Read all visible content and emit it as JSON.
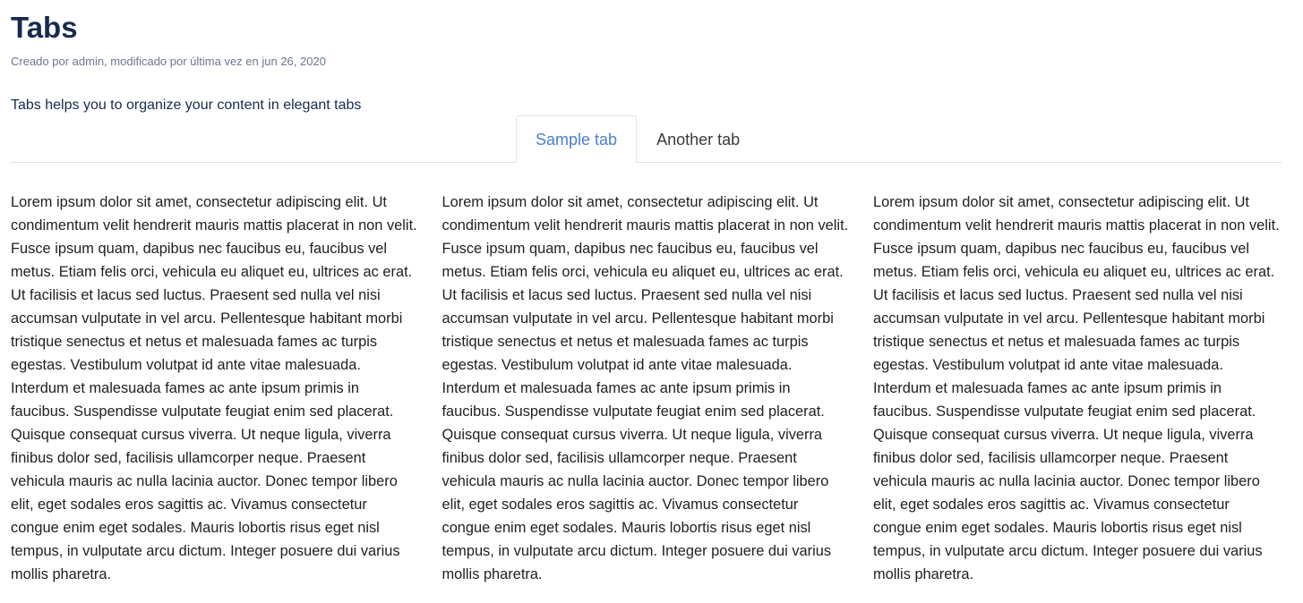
{
  "page": {
    "title": "Tabs",
    "meta": "Creado por admin, modificado por última vez en jun 26, 2020",
    "intro": "Tabs helps you to organize your content in elegant tabs"
  },
  "tabs": [
    {
      "label": "Sample tab",
      "active": true
    },
    {
      "label": "Another tab",
      "active": false
    }
  ],
  "columns": [
    {
      "text": "Lorem ipsum dolor sit amet, consectetur adipiscing elit. Ut condimentum velit hendrerit mauris mattis placerat in non velit. Fusce ipsum quam, dapibus nec faucibus eu, faucibus vel metus. Etiam felis orci, vehicula eu aliquet eu, ultrices ac erat. Ut facilisis et lacus sed luctus. Praesent sed nulla vel nisi accumsan vulputate in vel arcu. Pellentesque habitant morbi tristique senectus et netus et malesuada fames ac turpis egestas. Vestibulum volutpat id ante vitae malesuada. Interdum et malesuada fames ac ante ipsum primis in faucibus. Suspendisse vulputate feugiat enim sed placerat. Quisque consequat cursus viverra. Ut neque ligula, viverra finibus dolor sed, facilisis ullamcorper neque. Praesent vehicula mauris ac nulla lacinia auctor. Donec tempor libero elit, eget sodales eros sagittis ac. Vivamus consectetur congue enim eget sodales. Mauris lobortis risus eget nisl tempus, in vulputate arcu dictum. Integer posuere dui varius mollis pharetra."
    },
    {
      "text": "Lorem ipsum dolor sit amet, consectetur adipiscing elit. Ut condimentum velit hendrerit mauris mattis placerat in non velit. Fusce ipsum quam, dapibus nec faucibus eu, faucibus vel metus. Etiam felis orci, vehicula eu aliquet eu, ultrices ac erat. Ut facilisis et lacus sed luctus. Praesent sed nulla vel nisi accumsan vulputate in vel arcu. Pellentesque habitant morbi tristique senectus et netus et malesuada fames ac turpis egestas. Vestibulum volutpat id ante vitae malesuada. Interdum et malesuada fames ac ante ipsum primis in faucibus. Suspendisse vulputate feugiat enim sed placerat. Quisque consequat cursus viverra. Ut neque ligula, viverra finibus dolor sed, facilisis ullamcorper neque. Praesent vehicula mauris ac nulla lacinia auctor. Donec tempor libero elit, eget sodales eros sagittis ac. Vivamus consectetur congue enim eget sodales. Mauris lobortis risus eget nisl tempus, in vulputate arcu dictum. Integer posuere dui varius mollis pharetra."
    },
    {
      "text": "Lorem ipsum dolor sit amet, consectetur adipiscing elit. Ut condimentum velit hendrerit mauris mattis placerat in non velit. Fusce ipsum quam, dapibus nec faucibus eu, faucibus vel metus. Etiam felis orci, vehicula eu aliquet eu, ultrices ac erat. Ut facilisis et lacus sed luctus. Praesent sed nulla vel nisi accumsan vulputate in vel arcu. Pellentesque habitant morbi tristique senectus et netus et malesuada fames ac turpis egestas. Vestibulum volutpat id ante vitae malesuada. Interdum et malesuada fames ac ante ipsum primis in faucibus. Suspendisse vulputate feugiat enim sed placerat. Quisque consequat cursus viverra. Ut neque ligula, viverra finibus dolor sed, facilisis ullamcorper neque. Praesent vehicula mauris ac nulla lacinia auctor. Donec tempor libero elit, eget sodales eros sagittis ac. Vivamus consectetur congue enim eget sodales. Mauris lobortis risus eget nisl tempus, in vulputate arcu dictum. Integer posuere dui varius mollis pharetra."
    }
  ],
  "colors": {
    "title": "#172b4d",
    "meta": "#6b778c",
    "active_tab": "#4a7fd0",
    "tab_border": "#dee2e6"
  }
}
